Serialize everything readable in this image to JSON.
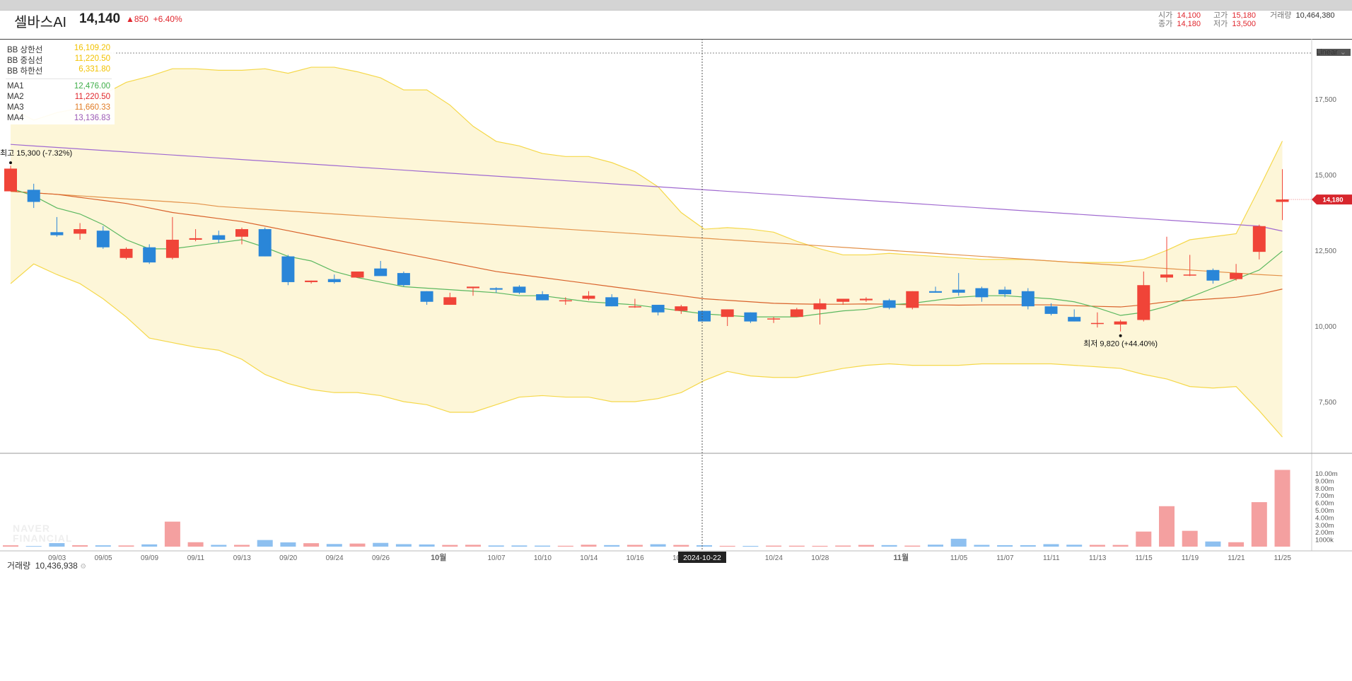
{
  "header": {
    "stock_name": "셀바스AI",
    "price": "14,140",
    "change_abs": "▲850",
    "change_pct": "+6.40%",
    "ohlc": {
      "open_label": "시가",
      "open": "14,100",
      "high_label": "고가",
      "high": "15,180",
      "close_label": "종가",
      "close": "14,180",
      "low_label": "저가",
      "low": "13,500",
      "volume_label": "거래량",
      "volume": "10,464,380"
    }
  },
  "scale_button": "Linear",
  "legend": {
    "bb": [
      {
        "label": "BB 상한선",
        "value": "16,109.20",
        "color": "#f2c200"
      },
      {
        "label": "BB 중심선",
        "value": "11,220.50",
        "color": "#f2c200"
      },
      {
        "label": "BB 하한선",
        "value": "6,331.80",
        "color": "#f2c200"
      }
    ],
    "ma": [
      {
        "label": "MA1",
        "value": "12,476.00",
        "color": "#3fae49"
      },
      {
        "label": "MA2",
        "value": "11,220.50",
        "color": "#e0262d"
      },
      {
        "label": "MA3",
        "value": "11,660.33",
        "color": "#e07b26"
      },
      {
        "label": "MA4",
        "value": "13,136.83",
        "color": "#9b59b6"
      }
    ]
  },
  "annotations": {
    "high": "최고 15,300 (-7.32%)",
    "low": "최저 9,820 (+44.40%)"
  },
  "crosshair_date": "2024-10-22",
  "current_price_tag": "14,180",
  "volume_panel": {
    "label": "거래량",
    "value": "10,436,938"
  },
  "watermark": [
    "NAVER",
    "FINANCIAL"
  ],
  "colors": {
    "up": "#f04438",
    "down": "#2a86d8",
    "vol_up": "#f4a0a0",
    "vol_down": "#8ec0f0",
    "bb_line": "#f5d84a",
    "bb_fill": "#fdf6d8"
  },
  "chart_data": {
    "type": "candlestick",
    "price_axis": {
      "ticks": [
        7500,
        10000,
        12500,
        15000,
        17500
      ],
      "tick_labels": [
        "7,500",
        "10,000",
        "12,500",
        "15,000",
        "17,500"
      ]
    },
    "volume_axis": {
      "ticks": [
        1000000,
        2000000,
        3000000,
        4000000,
        5000000,
        6000000,
        7000000,
        8000000,
        9000000,
        10000000
      ],
      "tick_labels": [
        "1000k",
        "2.00m",
        "3.00m",
        "4.00m",
        "5.00m",
        "6.00m",
        "7.00m",
        "8.00m",
        "9.00m",
        "10.00m"
      ]
    },
    "x_tick_labels": [
      "09/03",
      "09/05",
      "09/09",
      "09/11",
      "09/13",
      "09/20",
      "09/24",
      "09/26",
      "10월",
      "10/07",
      "10/10",
      "10/14",
      "10/16",
      "10/18",
      "10/24",
      "10/28",
      "11월",
      "11/05",
      "11/07",
      "11/11",
      "11/13",
      "11/15",
      "11/19",
      "11/21",
      "11/25"
    ],
    "x_tick_index": [
      1,
      3,
      5,
      7,
      9,
      11,
      13,
      15,
      17.5,
      20,
      22,
      24,
      26,
      28,
      32,
      34,
      37.5,
      40,
      42,
      44,
      46,
      48,
      50,
      52,
      54
    ],
    "candles": [
      {
        "o": 14450,
        "h": 15300,
        "l": 14450,
        "c": 15200
      },
      {
        "o": 14500,
        "h": 14700,
        "l": 13900,
        "c": 14100
      },
      {
        "o": 13100,
        "h": 13600,
        "l": 12950,
        "c": 13000
      },
      {
        "o": 13050,
        "h": 13400,
        "l": 12850,
        "c": 13200
      },
      {
        "o": 13150,
        "h": 13300,
        "l": 12550,
        "c": 12600
      },
      {
        "o": 12250,
        "h": 12600,
        "l": 12200,
        "c": 12550
      },
      {
        "o": 12600,
        "h": 12700,
        "l": 12050,
        "c": 12100
      },
      {
        "o": 12250,
        "h": 13600,
        "l": 12200,
        "c": 12850
      },
      {
        "o": 12850,
        "h": 13200,
        "l": 12800,
        "c": 12900
      },
      {
        "o": 13000,
        "h": 13150,
        "l": 12750,
        "c": 12850
      },
      {
        "o": 12950,
        "h": 13250,
        "l": 12700,
        "c": 13200
      },
      {
        "o": 13200,
        "h": 13250,
        "l": 12300,
        "c": 12300
      },
      {
        "o": 12300,
        "h": 12350,
        "l": 11350,
        "c": 11450
      },
      {
        "o": 11450,
        "h": 11500,
        "l": 11400,
        "c": 11500
      },
      {
        "o": 11550,
        "h": 11700,
        "l": 11400,
        "c": 11450
      },
      {
        "o": 11600,
        "h": 11800,
        "l": 11600,
        "c": 11800
      },
      {
        "o": 11900,
        "h": 12150,
        "l": 11700,
        "c": 11650
      },
      {
        "o": 11750,
        "h": 11800,
        "l": 11300,
        "c": 11350
      },
      {
        "o": 11150,
        "h": 11150,
        "l": 10700,
        "c": 10800
      },
      {
        "o": 10700,
        "h": 11100,
        "l": 10700,
        "c": 10950
      },
      {
        "o": 11250,
        "h": 11300,
        "l": 11000,
        "c": 11300
      },
      {
        "o": 11250,
        "h": 11280,
        "l": 11100,
        "c": 11200
      },
      {
        "o": 11300,
        "h": 11350,
        "l": 11050,
        "c": 11100
      },
      {
        "o": 11050,
        "h": 11150,
        "l": 10850,
        "c": 10850
      },
      {
        "o": 10850,
        "h": 10950,
        "l": 10700,
        "c": 10850
      },
      {
        "o": 10900,
        "h": 11150,
        "l": 10850,
        "c": 11000
      },
      {
        "o": 10950,
        "h": 11050,
        "l": 10650,
        "c": 10650
      },
      {
        "o": 10650,
        "h": 10900,
        "l": 10600,
        "c": 10650
      },
      {
        "o": 10700,
        "h": 10700,
        "l": 10350,
        "c": 10450
      },
      {
        "o": 10500,
        "h": 10700,
        "l": 10400,
        "c": 10650
      },
      {
        "o": 10500,
        "h": 10500,
        "l": 10200,
        "c": 10150
      },
      {
        "o": 10300,
        "h": 10550,
        "l": 10000,
        "c": 10550
      },
      {
        "o": 10450,
        "h": 10450,
        "l": 10100,
        "c": 10150
      },
      {
        "o": 10250,
        "h": 10300,
        "l": 10100,
        "c": 10250
      },
      {
        "o": 10300,
        "h": 10600,
        "l": 10300,
        "c": 10550
      },
      {
        "o": 10550,
        "h": 10900,
        "l": 10050,
        "c": 10750
      },
      {
        "o": 10800,
        "h": 10900,
        "l": 10700,
        "c": 10900
      },
      {
        "o": 10850,
        "h": 10950,
        "l": 10800,
        "c": 10900
      },
      {
        "o": 10850,
        "h": 10900,
        "l": 10550,
        "c": 10600
      },
      {
        "o": 10600,
        "h": 11150,
        "l": 10550,
        "c": 11150
      },
      {
        "o": 11150,
        "h": 11300,
        "l": 11100,
        "c": 11100
      },
      {
        "o": 11200,
        "h": 11750,
        "l": 11000,
        "c": 11100
      },
      {
        "o": 11250,
        "h": 11300,
        "l": 10800,
        "c": 10950
      },
      {
        "o": 11200,
        "h": 11300,
        "l": 10950,
        "c": 11050
      },
      {
        "o": 11150,
        "h": 11250,
        "l": 10550,
        "c": 10650
      },
      {
        "o": 10650,
        "h": 10750,
        "l": 10350,
        "c": 10400
      },
      {
        "o": 10300,
        "h": 10550,
        "l": 10150,
        "c": 10150
      },
      {
        "o": 10100,
        "h": 10450,
        "l": 9950,
        "c": 10100
      },
      {
        "o": 10050,
        "h": 10200,
        "l": 9820,
        "c": 10150
      },
      {
        "o": 10200,
        "h": 11800,
        "l": 10150,
        "c": 11350
      },
      {
        "o": 11600,
        "h": 12950,
        "l": 11450,
        "c": 11700
      },
      {
        "o": 11700,
        "h": 12350,
        "l": 11650,
        "c": 11700
      },
      {
        "o": 11850,
        "h": 11900,
        "l": 11400,
        "c": 11500
      },
      {
        "o": 11550,
        "h": 12050,
        "l": 11500,
        "c": 11750
      },
      {
        "o": 12450,
        "h": 13350,
        "l": 12200,
        "c": 13300
      },
      {
        "o": 14100,
        "h": 15180,
        "l": 13500,
        "c": 14180
      }
    ],
    "volume": [
      180000,
      80000,
      480000,
      190000,
      180000,
      160000,
      310000,
      3400000,
      600000,
      240000,
      240000,
      900000,
      580000,
      470000,
      360000,
      420000,
      510000,
      340000,
      300000,
      230000,
      250000,
      160000,
      160000,
      140000,
      120000,
      260000,
      210000,
      240000,
      330000,
      230000,
      190000,
      110000,
      100000,
      140000,
      130000,
      110000,
      150000,
      230000,
      210000,
      140000,
      270000,
      1070000,
      240000,
      200000,
      200000,
      340000,
      260000,
      240000,
      230000,
      2050000,
      5500000,
      2150000,
      700000,
      600000,
      6050000,
      10436938
    ],
    "ma1": [
      14550,
      14300,
      13900,
      13700,
      13350,
      12850,
      12550,
      12550,
      12650,
      12750,
      12850,
      12600,
      12300,
      12150,
      11800,
      11600,
      11450,
      11300,
      11250,
      11200,
      11150,
      11100,
      11000,
      11000,
      10900,
      10800,
      10750,
      10700,
      10600,
      10500,
      10400,
      10350,
      10300,
      10300,
      10300,
      10400,
      10500,
      10550,
      10700,
      10750,
      10850,
      10950,
      11000,
      11000,
      10950,
      10900,
      10800,
      10600,
      10350,
      10450,
      10650,
      10950,
      11250,
      11550,
      11850,
      12476
    ],
    "ma2": [
      14450,
      14400,
      14350,
      14250,
      14150,
      14050,
      13900,
      13750,
      13650,
      13550,
      13450,
      13300,
      13150,
      13000,
      12850,
      12700,
      12550,
      12400,
      12250,
      12100,
      11950,
      11800,
      11700,
      11600,
      11500,
      11400,
      11300,
      11200,
      11100,
      11000,
      10900,
      10850,
      10800,
      10750,
      10730,
      10720,
      10720,
      10730,
      10720,
      10700,
      10700,
      10690,
      10700,
      10700,
      10700,
      10700,
      10670,
      10650,
      10630,
      10700,
      10800,
      10850,
      10900,
      10950,
      11050,
      11220.5
    ],
    "ma3": [
      14450,
      14400,
      14350,
      14300,
      14250,
      14200,
      14150,
      14100,
      14050,
      13950,
      13900,
      13850,
      13800,
      13750,
      13700,
      13650,
      13600,
      13550,
      13500,
      13450,
      13400,
      13350,
      13300,
      13250,
      13200,
      13150,
      13100,
      13050,
      13000,
      12950,
      12900,
      12850,
      12800,
      12750,
      12700,
      12650,
      12600,
      12550,
      12500,
      12450,
      12400,
      12350,
      12300,
      12250,
      12200,
      12150,
      12100,
      12050,
      12000,
      11950,
      11900,
      11850,
      11800,
      11750,
      11700,
      11660.33
    ],
    "ma4": [
      16000,
      15950,
      15900,
      15850,
      15800,
      15750,
      15700,
      15650,
      15600,
      15550,
      15500,
      15450,
      15400,
      15350,
      15300,
      15250,
      15200,
      15150,
      15100,
      15050,
      15000,
      14950,
      14900,
      14850,
      14800,
      14750,
      14700,
      14650,
      14600,
      14550,
      14500,
      14450,
      14400,
      14350,
      14300,
      14250,
      14200,
      14150,
      14100,
      14050,
      14000,
      13950,
      13900,
      13850,
      13800,
      13750,
      13700,
      13650,
      13600,
      13550,
      13500,
      13450,
      13400,
      13350,
      13300,
      13136.83
    ],
    "bb_upper": [
      17200,
      16800,
      17050,
      17200,
      17650,
      18050,
      18250,
      18500,
      18500,
      18450,
      18450,
      18500,
      18350,
      18550,
      18550,
      18400,
      18200,
      17800,
      17800,
      17300,
      16600,
      16100,
      15950,
      15700,
      15600,
      15600,
      15400,
      15100,
      14600,
      13750,
      13200,
      13250,
      13200,
      13100,
      12800,
      12550,
      12350,
      12350,
      12400,
      12350,
      12300,
      12250,
      12200,
      12200,
      12200,
      12150,
      12100,
      12100,
      12100,
      12200,
      12500,
      12850,
      12950,
      13050,
      14550,
      16109.2
    ],
    "bb_lower": [
      11400,
      12050,
      11700,
      11400,
      10900,
      10300,
      9600,
      9450,
      9300,
      9200,
      8900,
      8400,
      8100,
      7900,
      7800,
      7800,
      7700,
      7500,
      7400,
      7150,
      7150,
      7400,
      7650,
      7700,
      7650,
      7650,
      7500,
      7500,
      7600,
      7800,
      8200,
      8500,
      8350,
      8300,
      8300,
      8450,
      8600,
      8700,
      8750,
      8700,
      8700,
      8700,
      8750,
      8750,
      8750,
      8750,
      8700,
      8650,
      8600,
      8400,
      8250,
      8000,
      7950,
      8000,
      7200,
      6331.8
    ]
  }
}
